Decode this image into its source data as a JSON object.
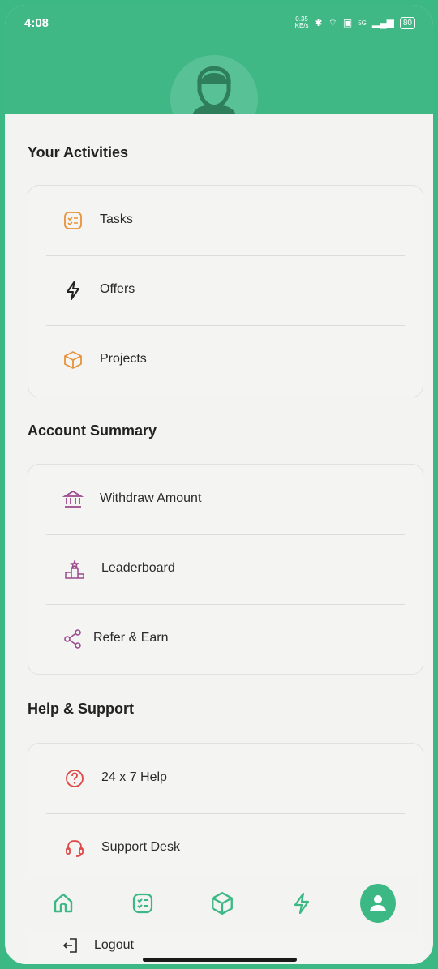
{
  "status_bar": {
    "time": "4:08",
    "net_speed_top": "0.35",
    "net_speed_bottom": "KB/s",
    "network": "5G",
    "battery": "80"
  },
  "sections": {
    "activities": {
      "title": "Your Activities",
      "items": [
        {
          "label": "Tasks",
          "icon": "checklist-icon"
        },
        {
          "label": "Offers",
          "icon": "lightning-icon"
        },
        {
          "label": "Projects",
          "icon": "box-icon"
        }
      ]
    },
    "account": {
      "title": "Account Summary",
      "items": [
        {
          "label": "Withdraw Amount",
          "icon": "bank-icon"
        },
        {
          "label": "Leaderboard",
          "icon": "podium-icon"
        },
        {
          "label": "Refer & Earn",
          "icon": "share-icon"
        }
      ]
    },
    "help": {
      "title": "Help & Support",
      "items": [
        {
          "label": "24 x 7 Help",
          "icon": "question-icon"
        },
        {
          "label": "Support Desk",
          "icon": "headset-icon"
        }
      ]
    }
  },
  "logout": {
    "label": "Logout",
    "icon": "logout-icon"
  },
  "bottom_nav": [
    "home-icon",
    "checklist-icon",
    "box-icon",
    "lightning-icon",
    "profile-icon"
  ],
  "colors": {
    "brand_green": "#40b886",
    "icon_orange": "#e8923a",
    "icon_purple": "#9b4a8c",
    "icon_red": "#e04848",
    "nav_green": "#3cb884"
  }
}
